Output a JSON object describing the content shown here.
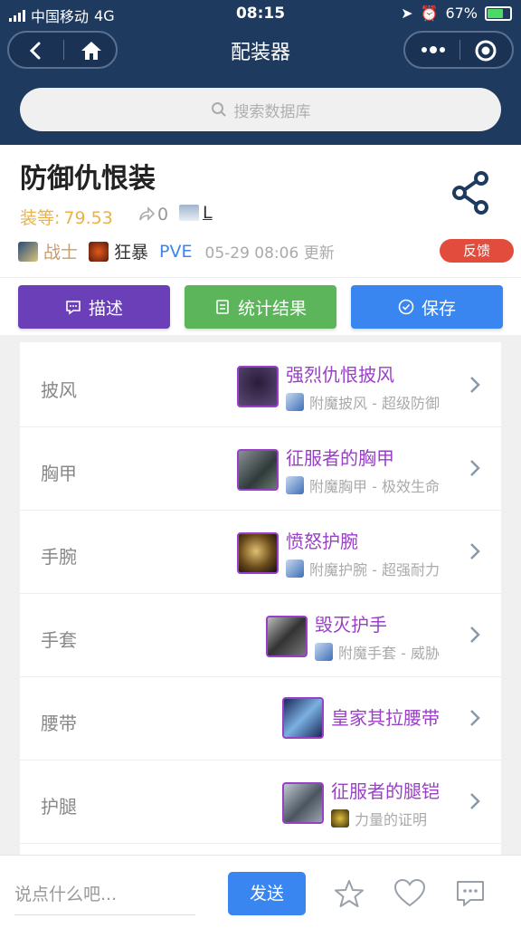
{
  "status_bar": {
    "carrier": "中国移动",
    "network": "4G",
    "time": "08:15",
    "battery": "67%"
  },
  "nav": {
    "title": "配装器"
  },
  "search": {
    "placeholder": "搜索数据库"
  },
  "build": {
    "title": "防御仇恨装",
    "item_level_label": "装等:",
    "item_level_value": "79.53",
    "share_count": "0",
    "owner": "L",
    "class_name": "战士",
    "spec_name": "狂暴",
    "mode": "PVE",
    "updated": "05-29 08:06 更新",
    "feedback_label": "反馈"
  },
  "actions": {
    "describe_label": "描述",
    "stats_label": "统计结果",
    "save_label": "保存"
  },
  "gear": [
    {
      "slot": "披风",
      "name": "强烈仇恨披风",
      "enchant": "附魔披风 - 超级防御"
    },
    {
      "slot": "胸甲",
      "name": "征服者的胸甲",
      "enchant": "附魔胸甲 - 极效生命"
    },
    {
      "slot": "手腕",
      "name": "愤怒护腕",
      "enchant": "附魔护腕 - 超强耐力"
    },
    {
      "slot": "手套",
      "name": "毁灭护手",
      "enchant": "附魔手套 - 威胁"
    },
    {
      "slot": "腰带",
      "name": "皇家其拉腰带",
      "enchant": ""
    },
    {
      "slot": "护腿",
      "name": "征服者的腿铠",
      "enchant": "力量的证明"
    }
  ],
  "footer": {
    "comment_placeholder": "说点什么吧...",
    "send_label": "发送"
  },
  "colors": {
    "nav_bg": "#1f3a5f",
    "epic": "#9a3fc8",
    "primary": "#3a86f0",
    "green": "#5cb55a",
    "purple": "#6b3fb8",
    "danger": "#e24c3c",
    "gold": "#e9b24a"
  }
}
